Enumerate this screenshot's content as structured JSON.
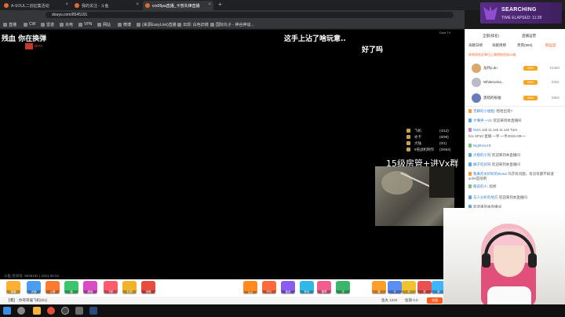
{
  "browser": {
    "tabs": [
      {
        "title": "A-SOUL二创征集活动"
      },
      {
        "title": "我的关注 - 斗鱼"
      },
      {
        "title": "crx05pa直播_卡普失律直播"
      }
    ],
    "url": "douyu.com/8545191",
    "bookmarks": [
      "直播",
      "CW",
      "雷诺",
      "充电",
      "VPN",
      "网站",
      "微博",
      "(来源EasyLink)直播",
      "出现: 白色旧镜",
      "国际丸子 - 神谷神谈..."
    ]
  },
  "video": {
    "danmu": [
      "残血 你在换弹",
      "这手上沾了啥玩意..",
      "好了吗"
    ],
    "corner_tag": "Dola TV",
    "user_tag": "DIYA",
    "scoreboard": [
      {
        "label": "飞机",
        "value": "(4/12)"
      },
      {
        "label": "亦卡",
        "value": "(6/99)"
      },
      {
        "label": "大陆",
        "value": "(0/1)"
      },
      {
        "label": "5倍战机制作",
        "value": "(2/664)"
      }
    ],
    "ad_text": "15级房管+进Vx群",
    "timestamp": "斗鱼 房间号: 8545191 | 2021.06.02"
  },
  "giftbar": {
    "gifts": [
      {
        "label": "弹幕",
        "color": "#ffb031"
      },
      {
        "label": "天使",
        "color": "#4b9df0"
      },
      {
        "label": "火箭",
        "color": "#ff7a2f"
      },
      {
        "label": "猛",
        "color": "#3ec46d"
      },
      {
        "label": "超级",
        "color": "#d84cc4"
      },
      {
        "label": "飞机",
        "color": "#ff5d6e"
      },
      {
        "label": "礼物",
        "color": "#f0b428"
      },
      {
        "label": "宝箱",
        "color": "#e84c3d"
      },
      {
        "label": "618",
        "color": "#ff8a1e"
      },
      {
        "label": "节日",
        "color": "#ff6a3d"
      },
      {
        "label": "抽奖",
        "color": "#8a5cf0"
      },
      {
        "label": "粉丝",
        "color": "#2fb8e8"
      },
      {
        "label": "徽章",
        "color": "#f35c8f"
      },
      {
        "label": "冲",
        "color": "#3bb66b"
      },
      {
        "label": "星",
        "color": "#ff9e2a"
      },
      {
        "label": "卡",
        "color": "#5b8ef5"
      },
      {
        "label": "卡",
        "color": "#f2c230"
      },
      {
        "label": "奖",
        "color": "#ea5050"
      },
      {
        "label": "彩",
        "color": "#3fb4ff"
      }
    ],
    "info_left": "【遭】: 你哥哥偏飞机(0/1)",
    "info_mid": "鱼丸 1222",
    "info_right": "鱼翅 0.0",
    "recharge": "充值"
  },
  "right_panel": {
    "header_tabs": [
      "全部(排名)",
      "直播运营"
    ],
    "sub_tabs": [
      "贡献日榜",
      "贡献周榜",
      "贵宾(583)",
      "粉丝团"
    ],
    "banner": "本房间社区单日上周热帖任选10组",
    "ranking": [
      {
        "name": "龙吟p.dn",
        "badge": "9999",
        "score": "15480",
        "avatar_color": "#d9a86c"
      },
      {
        "name": "Whiterumia...",
        "badge": "9999",
        "score": "8391",
        "avatar_color": "#b9bcc6"
      },
      {
        "name": "黑暗的祝福",
        "badge": "9999",
        "score": "6862",
        "avatar_color": "#6b7db8"
      }
    ],
    "chat": [
      {
        "badge": "",
        "name": "无聊的小姐姐",
        "text": "哈哈出现?"
      },
      {
        "badge": "",
        "name": "大嘴男一Vlc",
        "text": "欢迎来到本直播间"
      },
      {
        "badge": "",
        "name": "NW1",
        "text": "ssk 11 ssk 11 ssk Ture"
      },
      {
        "badge": "",
        "name": "...",
        "text": "hzL 6P10 直播 一手 一手2019~08~~"
      },
      {
        "badge": "",
        "name": "Nightsoul",
        "text": "5"
      },
      {
        "badge": "",
        "name": "大橙的小狗",
        "text": "欢迎来到本直播间"
      },
      {
        "badge": "",
        "name": "橘子吃好呀",
        "text": "欢迎来到本直播间"
      },
      {
        "badge": "",
        "name": "我真的太好听的Beats",
        "text": "玛莎有问题，有没有都不知道aché是啥吧"
      },
      {
        "badge": "",
        "name": "瞎说的人",
        "text": "指桥"
      },
      {
        "badge": "",
        "name": "与人分析的地方",
        "text": "欢迎来到本直播间"
      },
      {
        "badge": "",
        "name": "",
        "text": "欢迎来到本直播间"
      }
    ]
  },
  "overlay": {
    "status": "SEARCHING",
    "elapsed": "TIME ELAPSED: 11:28"
  },
  "taskbar": {
    "icons": [
      {
        "name": "start",
        "color": "#3a8de0"
      },
      {
        "name": "search",
        "color": "#888888"
      },
      {
        "name": "folder",
        "color": "#f2b43a"
      },
      {
        "name": "chrome",
        "color": "#e44d3a"
      },
      {
        "name": "obs",
        "color": "#444444"
      },
      {
        "name": "app",
        "color": "#6a6a6a"
      },
      {
        "name": "steam",
        "color": "#2a4a7a"
      }
    ]
  }
}
